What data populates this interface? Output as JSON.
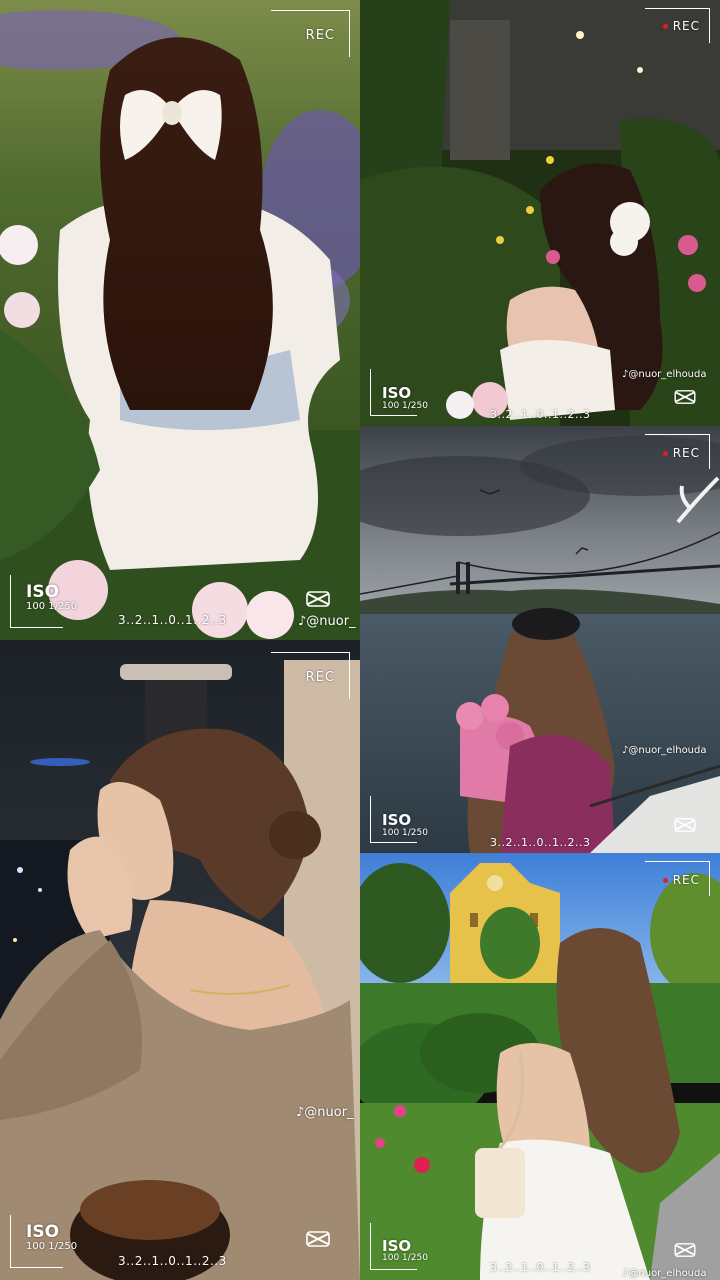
{
  "overlay": {
    "rec": "REC",
    "iso": "ISO",
    "iso_detail": "100 1/250",
    "countdown": "3..2..1..0..1..2..3",
    "tiktok_handle_full": "@nuor_elhouda",
    "tiktok_handle_cropped": "@nuor_",
    "capcut_icon": "capcut-logo"
  },
  "tiles": [
    {
      "name": "garden-bow-girl",
      "position": "top-left"
    },
    {
      "name": "roses-hair-girl",
      "position": "top-right"
    },
    {
      "name": "bosphorus-bridge-girl",
      "position": "middle-right"
    },
    {
      "name": "night-city-girl",
      "position": "bottom-left"
    },
    {
      "name": "park-building-girl",
      "position": "bottom-right"
    }
  ],
  "colors": {
    "rec_dot": "#e02020",
    "overlay_text": "#ffffff"
  }
}
